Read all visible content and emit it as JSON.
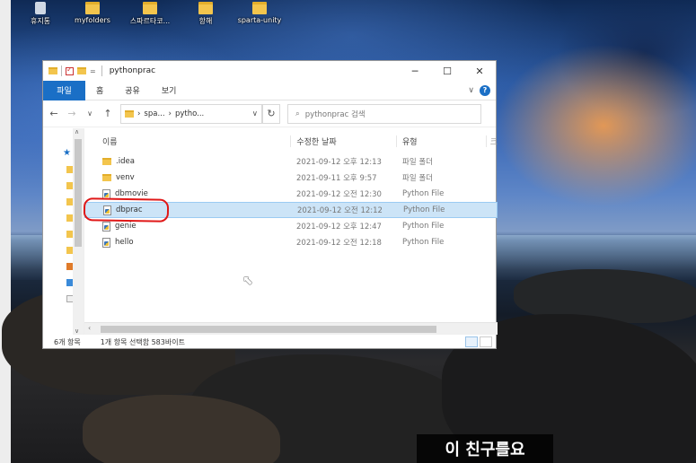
{
  "desktop": {
    "icons": [
      {
        "label": "휴지통",
        "icon": "recycle-bin-icon"
      },
      {
        "label": "myfolders",
        "icon": "folder-icon"
      },
      {
        "label": "스파르타코...",
        "icon": "folder-icon"
      },
      {
        "label": "항해",
        "icon": "folder-icon"
      },
      {
        "label": "sparta-unity",
        "icon": "folder-icon"
      }
    ]
  },
  "window": {
    "title": "pythonprac",
    "controls": {
      "minimize": "─",
      "maximize": "☐",
      "close": "✕"
    },
    "ribbon": {
      "file_tab": "파일",
      "tabs": [
        "홈",
        "공유",
        "보기"
      ]
    },
    "nav": {
      "back": "←",
      "forward": "→",
      "up": "↑",
      "address": [
        "spa...",
        "pytho..."
      ],
      "refresh": "↻",
      "search_placeholder": "pythonprac 검색"
    },
    "columns": {
      "name": "이름",
      "date": "수정한 날짜",
      "type": "유형",
      "extra": "크"
    },
    "files": [
      {
        "name": ".idea",
        "date": "2021-09-12 오후 12:13",
        "type": "파일 폴더",
        "kind": "folder",
        "selected": false
      },
      {
        "name": "venv",
        "date": "2021-09-11 오후 9:57",
        "type": "파일 폴더",
        "kind": "folder",
        "selected": false
      },
      {
        "name": "dbmovie",
        "date": "2021-09-12 오전 12:30",
        "type": "Python File",
        "kind": "python",
        "selected": false
      },
      {
        "name": "dbprac",
        "date": "2021-09-12 오전 12:12",
        "type": "Python File",
        "kind": "python",
        "selected": true
      },
      {
        "name": "genie",
        "date": "2021-09-12 오후 12:47",
        "type": "Python File",
        "kind": "python",
        "selected": false
      },
      {
        "name": "hello",
        "date": "2021-09-12 오전 12:18",
        "type": "Python File",
        "kind": "python",
        "selected": false
      }
    ],
    "status": {
      "count": "6개 항목",
      "selection": "1개 항목 선택함 583바이트"
    }
  },
  "subtitle": "이 친구를요",
  "colors": {
    "accent": "#1a6fc6",
    "selection": "#cce4f7",
    "annotation": "#e01818"
  }
}
